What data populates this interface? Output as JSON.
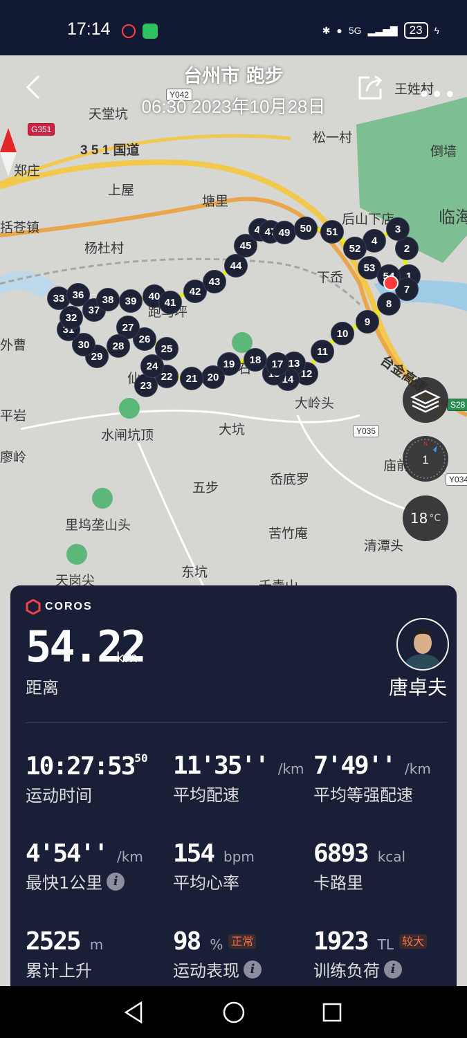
{
  "status_bar": {
    "time": "17:14",
    "battery": "23",
    "network": "5G"
  },
  "header": {
    "title": "台州市 跑步",
    "datetime": "06:30 2023年10月28日"
  },
  "map": {
    "places": [
      {
        "id": "tiantangkeng",
        "text": "天堂坑"
      },
      {
        "id": "zhengzhuang",
        "text": "郑庄"
      },
      {
        "id": "guodao351",
        "text": "3 5 1 国道"
      },
      {
        "id": "shangwu",
        "text": "上屋"
      },
      {
        "id": "tangli",
        "text": "塘里"
      },
      {
        "id": "songyicun",
        "text": "松一村"
      },
      {
        "id": "wangxingcun",
        "text": "王姓村"
      },
      {
        "id": "daoqiang",
        "text": "倒墙"
      },
      {
        "id": "kuocangzhen",
        "text": "括苍镇"
      },
      {
        "id": "yangducun",
        "text": "杨杜村"
      },
      {
        "id": "houshanxiadian",
        "text": "后山下店"
      },
      {
        "id": "lin",
        "text": "临海"
      },
      {
        "id": "xiachen",
        "text": "下岙"
      },
      {
        "id": "paomaping",
        "text": "跑马坪"
      },
      {
        "id": "waicao",
        "text": "外曹"
      },
      {
        "id": "pingyan",
        "text": "平岩"
      },
      {
        "id": "shuizhakengding",
        "text": "水闸坑顶"
      },
      {
        "id": "dakeng",
        "text": "大坑"
      },
      {
        "id": "dalingtou",
        "text": "大岭头"
      },
      {
        "id": "liaoling",
        "text": "廖岭"
      },
      {
        "id": "wubu",
        "text": "五步"
      },
      {
        "id": "xiandiluo",
        "text": "岙底罗"
      },
      {
        "id": "miaoqian",
        "text": "庙前"
      },
      {
        "id": "liwucuoshantou",
        "text": "里坞垄山头"
      },
      {
        "id": "kuzhuan",
        "text": "苦竹庵"
      },
      {
        "id": "qingtantou",
        "text": "清潭头"
      },
      {
        "id": "tiangangjian",
        "text": "天岗尖"
      },
      {
        "id": "dongkeng",
        "text": "东坑"
      },
      {
        "id": "qianqingshan",
        "text": "千青山"
      },
      {
        "id": "taijingaosu",
        "text": "台金高速"
      },
      {
        "id": "xian",
        "text": "仙"
      },
      {
        "id": "shi",
        "text": "石"
      }
    ],
    "road_badges": {
      "g351": "G351",
      "y042": "Y042",
      "y035": "Y035",
      "s28": "S28",
      "y034": "Y034"
    },
    "km_markers": [
      "1",
      "2",
      "3",
      "4",
      "7",
      "8",
      "9",
      "10",
      "11",
      "12",
      "13",
      "14",
      "15",
      "17",
      "18",
      "19",
      "20",
      "21",
      "22",
      "23",
      "24",
      "25",
      "26",
      "27",
      "28",
      "29",
      "30",
      "31",
      "32",
      "33",
      "36",
      "37",
      "38",
      "39",
      "40",
      "41",
      "42",
      "43",
      "44",
      "45",
      "46",
      "47",
      "49",
      "50",
      "51",
      "52",
      "53",
      "54"
    ],
    "compass_level": "1",
    "temperature": "18",
    "temperature_unit": "°C"
  },
  "card": {
    "brand": "COROS",
    "distance": "54.22",
    "distance_unit": "km",
    "distance_label": "距离",
    "user_name": "唐卓夫",
    "stats": [
      {
        "value": "10:27:53",
        "fraction": "50",
        "unit": "",
        "label": "运动时间"
      },
      {
        "value": "11'35''",
        "unit": "/km",
        "label": "平均配速"
      },
      {
        "value": "7'49''",
        "unit": "/km",
        "label": "平均等强配速"
      },
      {
        "value": "4'54''",
        "unit": "/km",
        "label": "最快1公里"
      },
      {
        "value": "154",
        "unit": "bpm",
        "label": "平均心率"
      },
      {
        "value": "6893",
        "unit": "kcal",
        "label": "卡路里"
      },
      {
        "value": "2525",
        "unit": "m",
        "label": "累计上升"
      },
      {
        "value": "98",
        "unit": "%",
        "badge": "正常",
        "label": "运动表现"
      },
      {
        "value": "1923",
        "unit": "TL",
        "badge": "较大",
        "label": "训练负荷"
      }
    ]
  },
  "colors": {
    "card_bg": "#1a1f38",
    "status_bg": "#121a33",
    "route": "#e8f000",
    "badge": "#f0744c"
  }
}
